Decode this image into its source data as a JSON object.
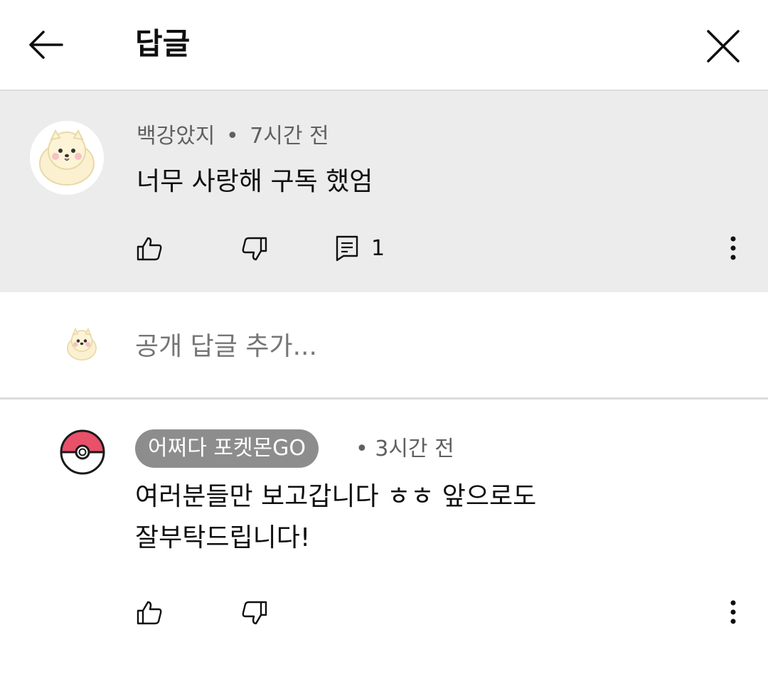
{
  "header": {
    "title": "답글",
    "back_icon": "arrow-left-icon",
    "close_icon": "close-icon"
  },
  "parent_comment": {
    "author": "백강았지",
    "separator": "•",
    "time": "7시간 전",
    "text": "너무 사랑해 구독 했엄",
    "reply_count": "1",
    "avatar": "pomeranian-avatar"
  },
  "add_reply": {
    "placeholder": "공개 답글 추가..."
  },
  "replies": [
    {
      "author": "어쩌다 포켓몬GO",
      "separator": "•",
      "time": "3시간 전",
      "text_line1": "여러분들만 보고갑니다 ㅎㅎ 앞으로도",
      "text_line2": "잘부탁드립니다!",
      "avatar": "pokeball-avatar"
    }
  ],
  "colors": {
    "background": "#ffffff",
    "highlight": "#ececec",
    "secondary_text": "#606060",
    "chip_background": "#8d8d8d",
    "pokeball_red": "#e9506a"
  }
}
